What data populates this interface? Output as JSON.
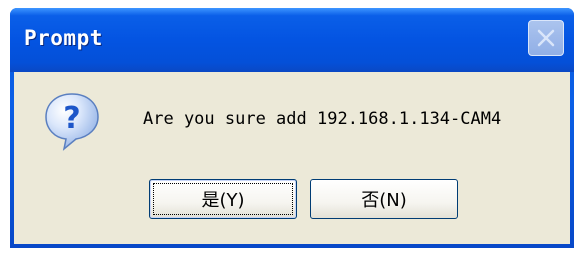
{
  "window": {
    "title": "Prompt",
    "close_icon": "close-icon"
  },
  "dialog": {
    "icon": "question-icon",
    "message": "Are you sure add 192.168.1.134-CAM4",
    "buttons": {
      "yes_label": "是(Y)",
      "no_label": "否(N)"
    }
  },
  "colors": {
    "titlebar": "#0454e2",
    "client_bg": "#ece9d8",
    "icon_blue": "#2f6fd6"
  }
}
